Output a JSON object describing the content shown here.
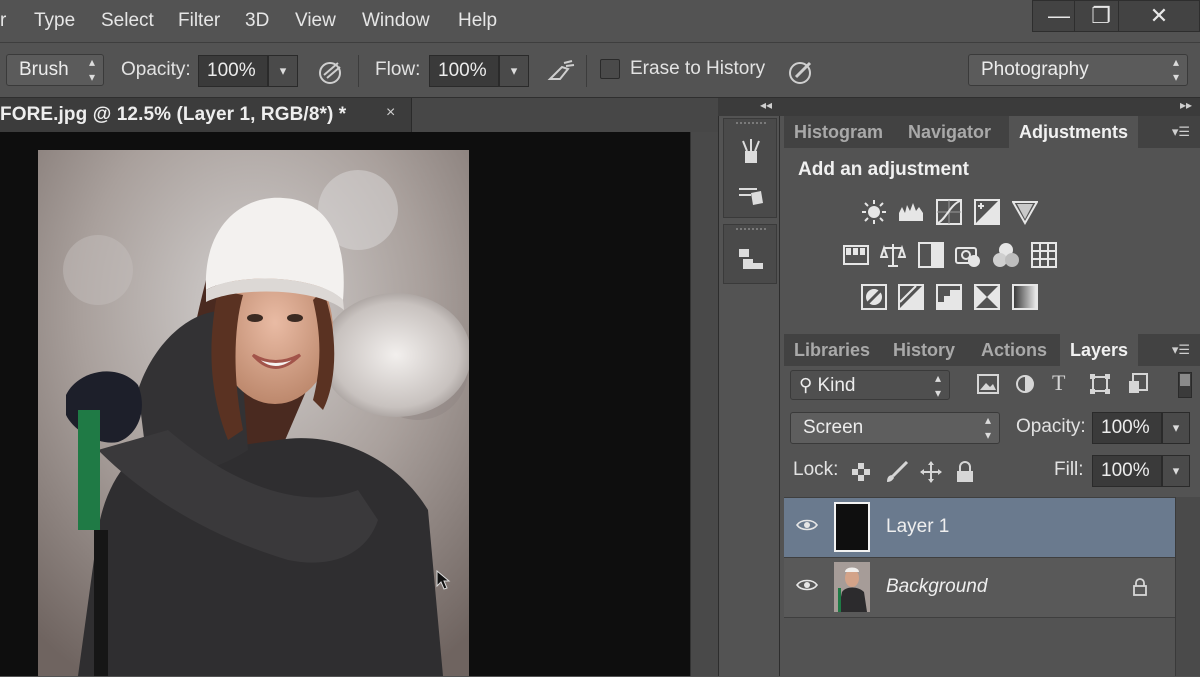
{
  "menu": {
    "partial_item": "r",
    "items": [
      "Type",
      "Select",
      "Filter",
      "3D",
      "View",
      "Window",
      "Help"
    ]
  },
  "window_controls": {
    "minimize": "—",
    "restore": "❐",
    "close": "✕"
  },
  "options_bar": {
    "tool_preset": "Brush",
    "opacity_label": "Opacity:",
    "opacity_value": "100%",
    "flow_label": "Flow:",
    "flow_value": "100%",
    "erase_to_history_label": "Erase to History",
    "erase_to_history_checked": false,
    "workspace": "Photography"
  },
  "document": {
    "tab_title": "FORE.jpg @ 12.5% (Layer 1, RGB/8*) *",
    "close_glyph": "×"
  },
  "adjustments_panel": {
    "tabs": [
      "Histogram",
      "Navigator",
      "Adjustments"
    ],
    "active_tab": "Adjustments",
    "title": "Add an adjustment",
    "icons_row1": [
      "brightness-contrast-icon",
      "levels-icon",
      "curves-icon",
      "exposure-icon",
      "vibrance-icon"
    ],
    "icons_row2": [
      "hue-saturation-icon",
      "color-balance-icon",
      "black-white-icon",
      "photo-filter-icon",
      "channel-mixer-icon",
      "color-lookup-icon"
    ],
    "icons_row3": [
      "invert-icon",
      "posterize-icon",
      "threshold-icon",
      "selective-color-icon",
      "gradient-map-icon"
    ]
  },
  "layers_panel": {
    "tabs": [
      "Libraries",
      "History",
      "Actions",
      "Layers"
    ],
    "active_tab": "Layers",
    "filter_kind": "Kind",
    "blend_mode": "Screen",
    "opacity_label": "Opacity:",
    "opacity_value": "100%",
    "lock_label": "Lock:",
    "fill_label": "Fill:",
    "fill_value": "100%",
    "layers": [
      {
        "name": "Layer 1",
        "visible": true,
        "selected": true,
        "locked": false
      },
      {
        "name": "Background",
        "visible": true,
        "selected": false,
        "locked": true
      }
    ]
  },
  "colors": {
    "chrome": "#535353",
    "canvas_bg": "#0e0e0e",
    "selected_layer": "#6a7a8e",
    "accent_green": "#1f7a45"
  }
}
